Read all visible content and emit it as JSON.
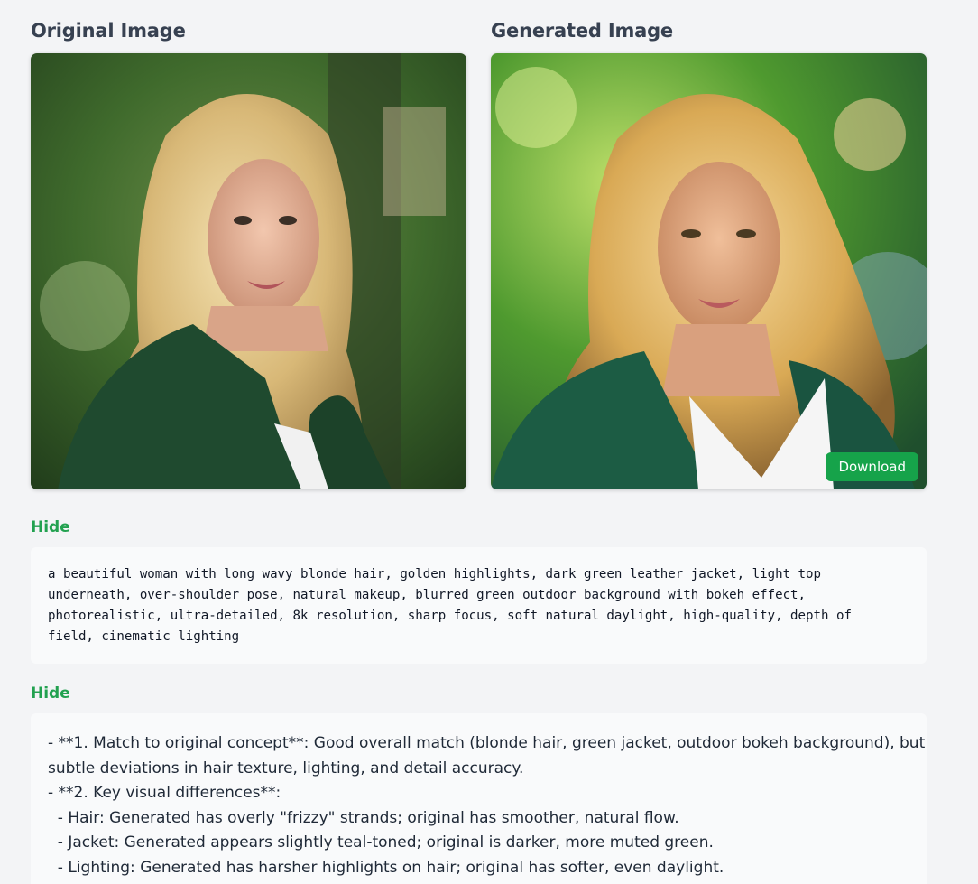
{
  "original": {
    "title": "Original Image",
    "image_description_icon": "portrait-photo-original"
  },
  "generated": {
    "title": "Generated Image",
    "image_description_icon": "portrait-photo-generated",
    "download_label": "Download"
  },
  "prompt_section": {
    "toggle_label": "Hide",
    "lines": [
      "a beautiful woman with long wavy blonde hair, golden highlights, dark green leather jacket, light top",
      "underneath, over-shoulder pose, natural makeup, blurred green outdoor background with bokeh effect,",
      "photorealistic, ultra-detailed, 8k resolution, sharp focus, soft natural daylight, high-quality, depth of",
      "field, cinematic lighting"
    ]
  },
  "evaluation_section": {
    "toggle_label": "Hide",
    "lines": [
      "- **1. Match to original concept**: Good overall match (blonde hair, green jacket, outdoor bokeh background), but",
      "subtle deviations in hair texture, lighting, and detail accuracy.",
      "- **2. Key visual differences**:",
      "  - Hair: Generated has overly \"frizzy\" strands; original has smoother, natural flow.",
      "  - Jacket: Generated appears slightly teal-toned; original is darker, more muted green.",
      "  - Lighting: Generated has harsher highlights on hair; original has softer, even daylight."
    ]
  },
  "colors": {
    "accent": "#22a150",
    "download_bg": "#16a34a",
    "page_bg": "#f3f4f6",
    "box_bg": "#f9fafb"
  }
}
